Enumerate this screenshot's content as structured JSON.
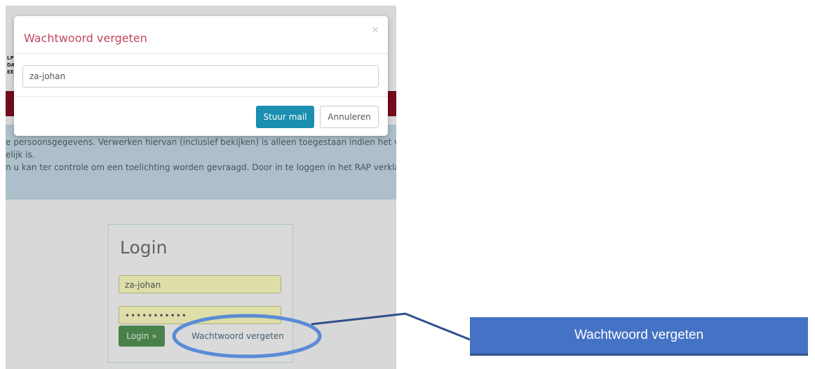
{
  "background_page": {
    "logo_fragment": [
      "LP",
      "DA",
      "EE"
    ],
    "notice_lines": [
      "e persoonsgegevens. Verwerken hiervan (inclusief bekijken) is alleen toegestaan indien het voor",
      "elijk is.",
      "n u kan ter controle om een toelichting worden gevraagd. Door in te loggen in het RAP verklaart"
    ]
  },
  "login": {
    "title": "Login",
    "username_value": "za-johan",
    "password_value": "•••••••••••",
    "login_button": "Login »",
    "forgot_link": "Wachtwoord vergeten"
  },
  "modal": {
    "title": "Wachtwoord vergeten",
    "close_glyph": "×",
    "input_value": "za-johan",
    "send_button": "Stuur mail",
    "cancel_button": "Annuleren"
  },
  "annotation": {
    "callout_label": "Wachtwoord vergeten",
    "ellipse_color": "#5b8bd6",
    "callout_color": "#4472c4"
  }
}
